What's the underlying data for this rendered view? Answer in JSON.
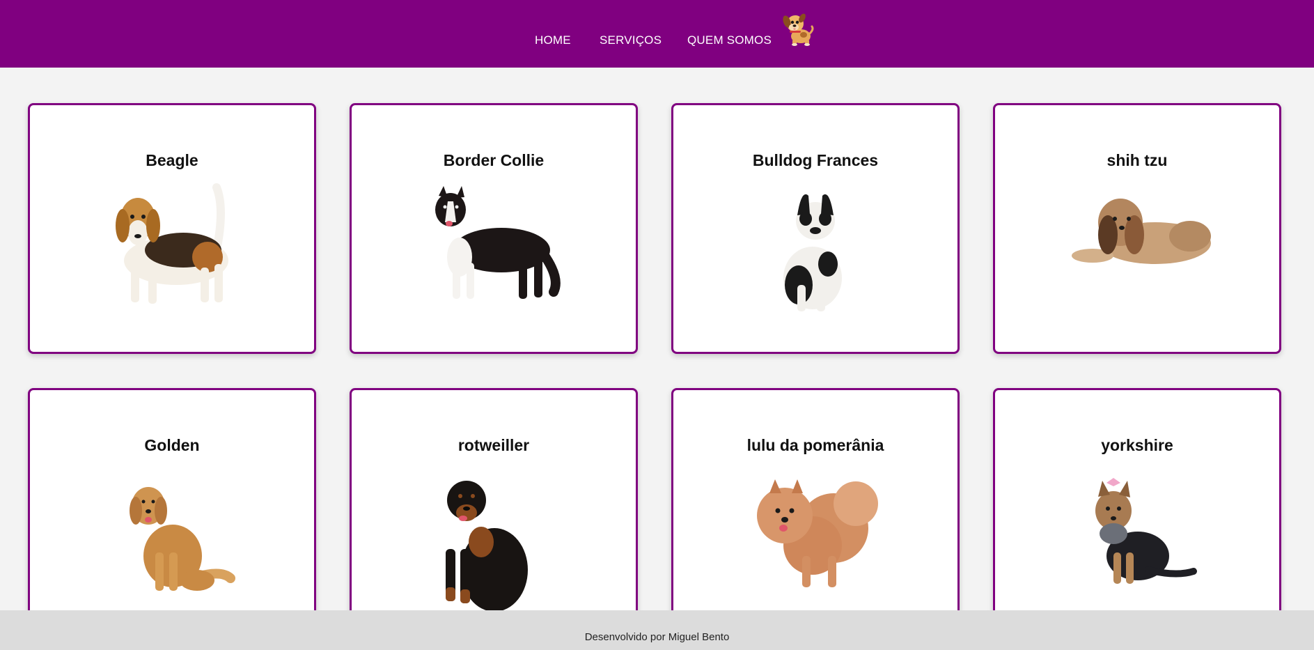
{
  "nav": {
    "home": "HOME",
    "services": "SERVIÇOS",
    "about": "QUEM SOMOS",
    "logo_icon": "cartoon-puppy-logo"
  },
  "colors": {
    "brand": "#800080",
    "page_bg": "#f3f3f3",
    "footer_bg": "#dcdcdc"
  },
  "breeds": [
    {
      "name": "Beagle",
      "icon": "beagle-image"
    },
    {
      "name": "Border Collie",
      "icon": "border-collie-image"
    },
    {
      "name": "Bulldog Frances",
      "icon": "french-bulldog-image"
    },
    {
      "name": "shih tzu",
      "icon": "shih-tzu-image"
    },
    {
      "name": "Golden",
      "icon": "golden-retriever-image"
    },
    {
      "name": "rotweiller",
      "icon": "rottweiler-image"
    },
    {
      "name": "lulu da pomerânia",
      "icon": "pomeranian-image"
    },
    {
      "name": "yorkshire",
      "icon": "yorkshire-image"
    }
  ],
  "footer": {
    "text": "Desenvolvido por Miguel Bento"
  }
}
